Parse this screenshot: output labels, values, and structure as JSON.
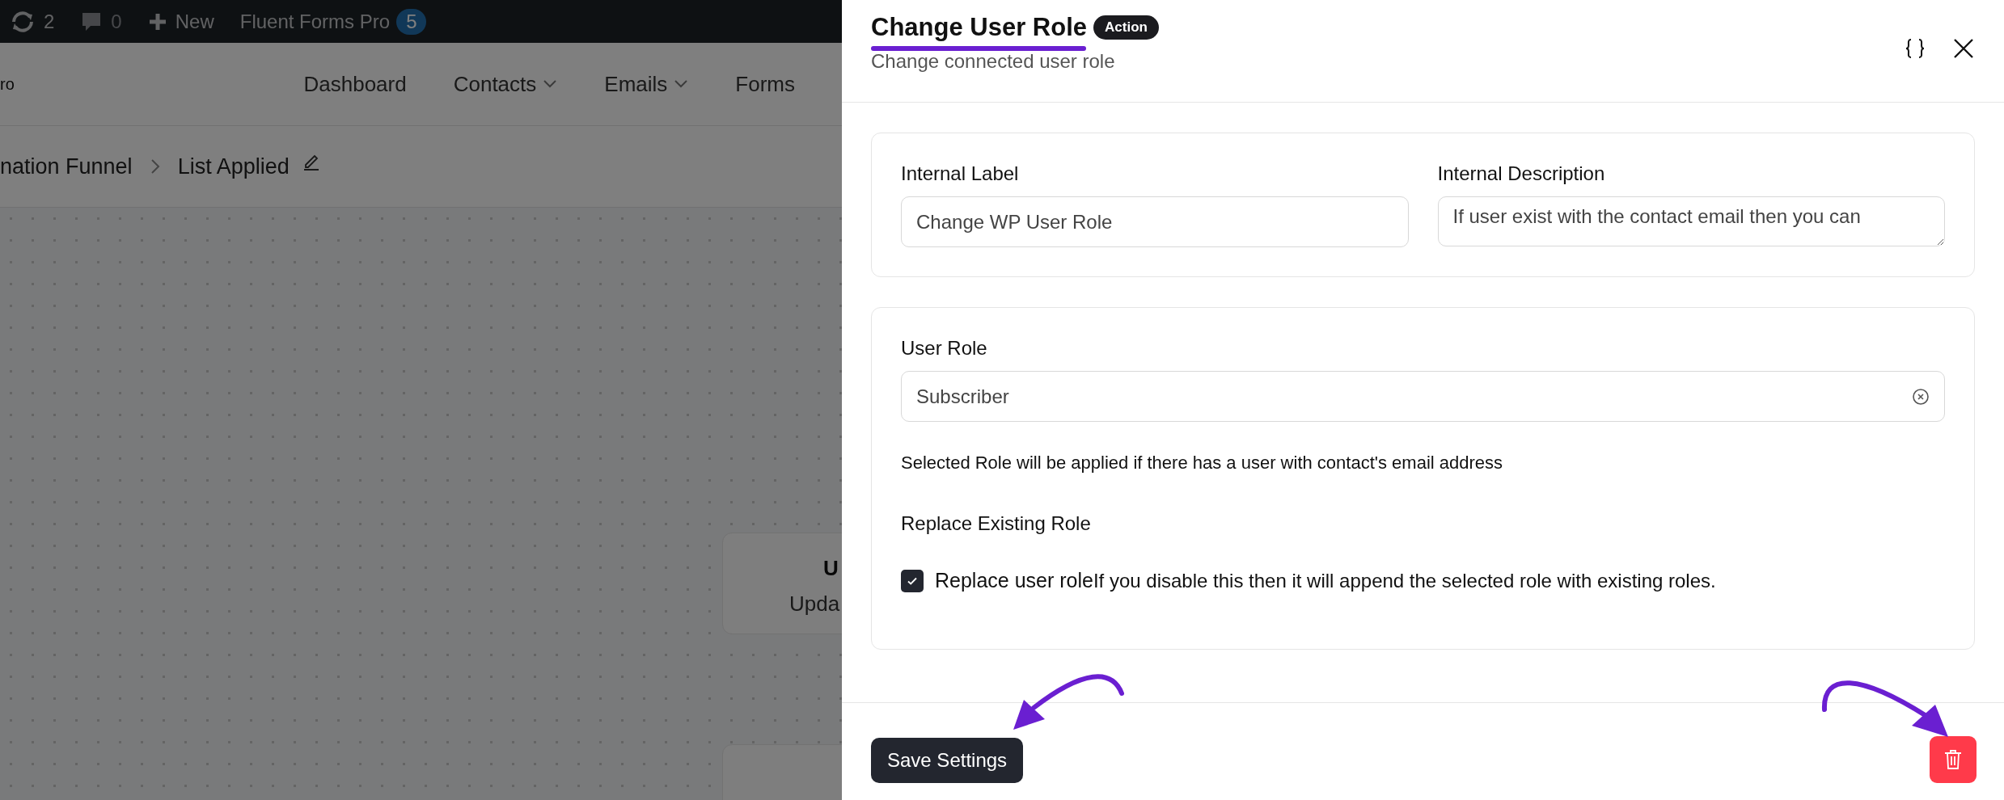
{
  "admin_bar": {
    "updates": "2",
    "comments": "0",
    "new": "New",
    "plugin": "Fluent Forms Pro",
    "plugin_badge": "5"
  },
  "header": {
    "logo_text": "ro",
    "nav": [
      {
        "label": "Dashboard",
        "dropdown": false
      },
      {
        "label": "Contacts",
        "dropdown": true
      },
      {
        "label": "Emails",
        "dropdown": true
      },
      {
        "label": "Forms",
        "dropdown": false
      }
    ]
  },
  "breadcrumb": [
    "nation Funnel",
    "List Applied"
  ],
  "canvas": {
    "nodes": [
      {
        "title": "U",
        "subtitle": "Upda"
      }
    ]
  },
  "drawer": {
    "title": "Change User Role",
    "badge": "Action",
    "subtitle": "Change connected user role",
    "sections": [
      {
        "fields": [
          {
            "kind": "input",
            "label": "Internal Label",
            "value": "Change WP User Role"
          },
          {
            "kind": "textarea",
            "label": "Internal Description",
            "value": "If user exist with the contact email then you can"
          }
        ]
      },
      {
        "fields": [
          {
            "kind": "select",
            "label": "User Role",
            "value": "Subscriber",
            "help": "Selected Role will be applied if there has a user with contact's email address"
          },
          {
            "kind": "checkbox",
            "label": "Replace Existing Role",
            "option": "Replace user role",
            "description": "If you disable this then it will append the selected role with existing roles.",
            "checked": true
          }
        ]
      }
    ],
    "save": "Save Settings"
  }
}
